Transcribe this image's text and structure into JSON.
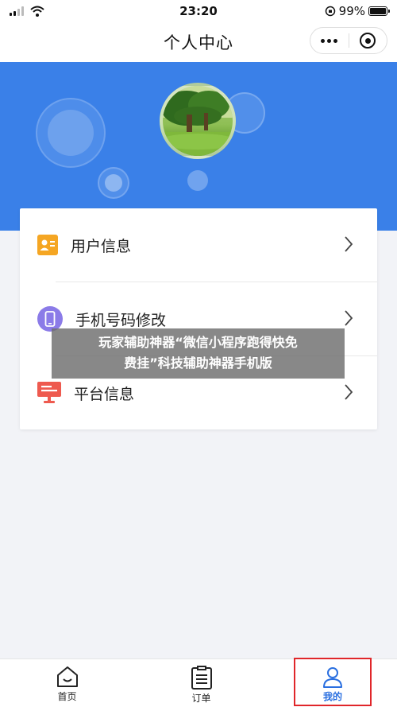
{
  "status_bar": {
    "time": "23:20",
    "battery": "99%",
    "battery_level": 0.99
  },
  "nav": {
    "title": "个人中心",
    "more_icon": "more-dots-icon",
    "close_icon": "target-icon"
  },
  "colors": {
    "banner": "#3a80e8",
    "active_tab": "#2a6fe0",
    "highlight_border": "#e0262a"
  },
  "menu": {
    "items": [
      {
        "label": "用户信息",
        "icon": "user-info-icon",
        "icon_color": "#f5a623"
      },
      {
        "label": "手机号码修改",
        "icon": "phone-icon",
        "icon_color": "#8b7be8"
      },
      {
        "label": "平台信息",
        "icon": "monitor-icon",
        "icon_color": "#ee5a4f"
      }
    ]
  },
  "overlay": {
    "line1": "玩家辅助神器“微信小程序跑得快免",
    "line2": "费挂”科技辅助神器手机版"
  },
  "tabbar": {
    "items": [
      {
        "label": "首页",
        "icon": "home-icon"
      },
      {
        "label": "订单",
        "icon": "order-list-icon"
      },
      {
        "label": "我的",
        "icon": "user-icon",
        "active": true
      }
    ]
  }
}
